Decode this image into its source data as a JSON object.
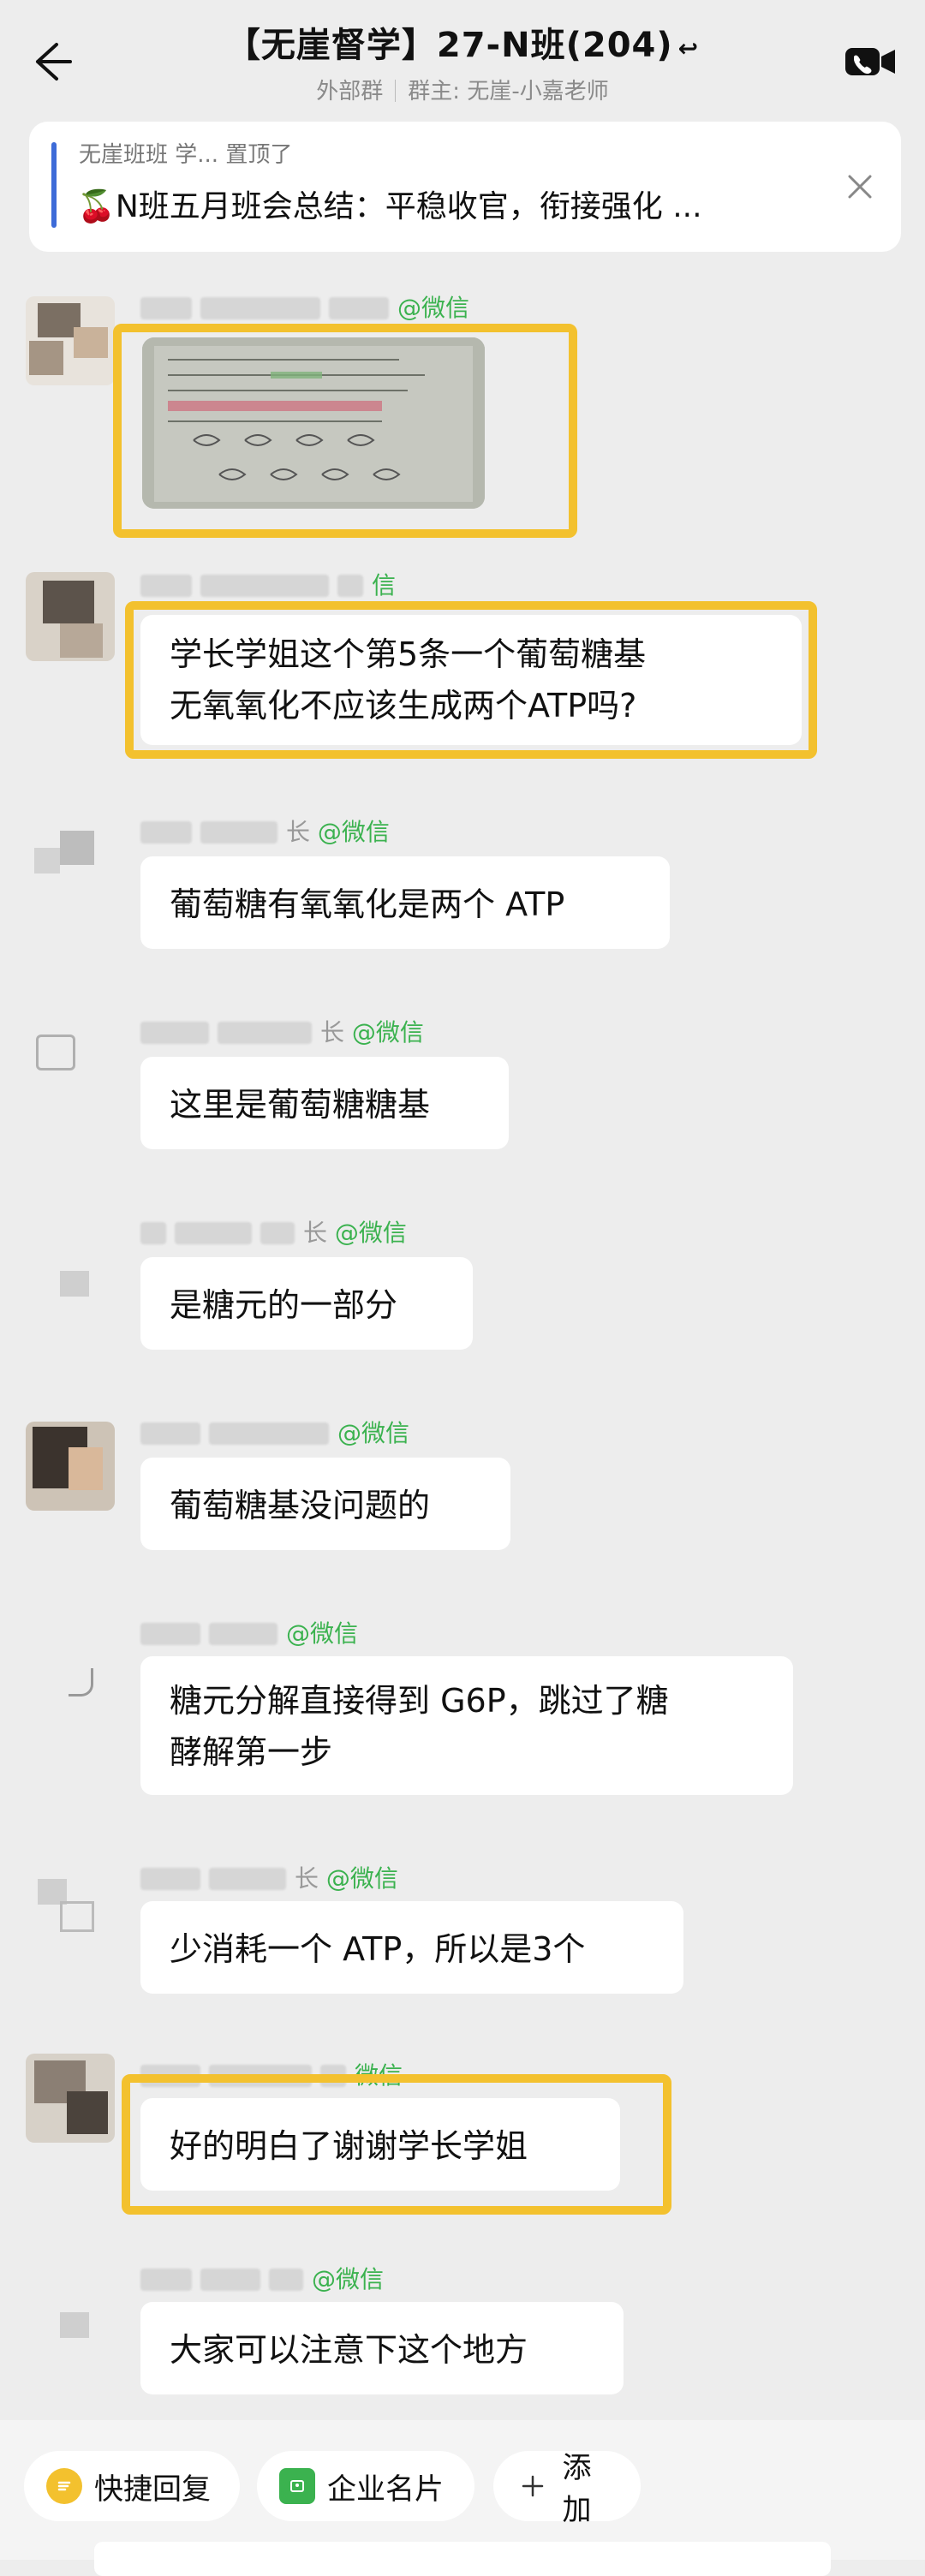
{
  "header": {
    "title": "【无崖督学】27-N班(204)",
    "ear_icon": "ear-icon",
    "sub_left": "外部群",
    "sub_right": "群主: 无崖-小嘉老师"
  },
  "pinned": {
    "line1": "无崖班班   学...   置顶了",
    "line2": "🍒N班五月班会总结：平稳收官，衔接强化 ...",
    "close_icon": "close-icon"
  },
  "messages": [
    {
      "sender_blur": "27...",
      "tag": "@微信",
      "type": "image"
    },
    {
      "sender_blur": "27...",
      "tag": "信",
      "text": "学长学姐这个第5条一个葡萄糖基\n无氧氧化不应该生成两个ATP吗?"
    },
    {
      "sender_tail": "长",
      "tag": "@微信",
      "text": "葡萄糖有氧氧化是两个 ATP"
    },
    {
      "sender_tail": "长",
      "tag": "@微信",
      "text": "这里是葡萄糖糖基"
    },
    {
      "sender_tail": "长",
      "tag": "@微信",
      "text": "是糖元的一部分"
    },
    {
      "sender_tail": "",
      "tag": "@微信",
      "text": "葡萄糖基没问题的"
    },
    {
      "sender_tail": "",
      "tag": "@微信",
      "text": "糖元分解直接得到 G6P，跳过了糖\n酵解第一步"
    },
    {
      "sender_tail": "长",
      "tag": "@微信",
      "text": "少消耗一个 ATP，所以是3个"
    },
    {
      "sender_tail": "",
      "tag": "微信",
      "text": "好的明白了谢谢学长学姐"
    },
    {
      "sender_tail": "",
      "tag": "@微信",
      "text": "大家可以注意下这个地方"
    }
  ],
  "quickbar": {
    "reply": "快捷回复",
    "card": "企业名片",
    "add": "添加"
  },
  "colors": {
    "highlight": "#f3c12e",
    "wechat_green": "#3bb24f",
    "bg": "#ededed"
  }
}
